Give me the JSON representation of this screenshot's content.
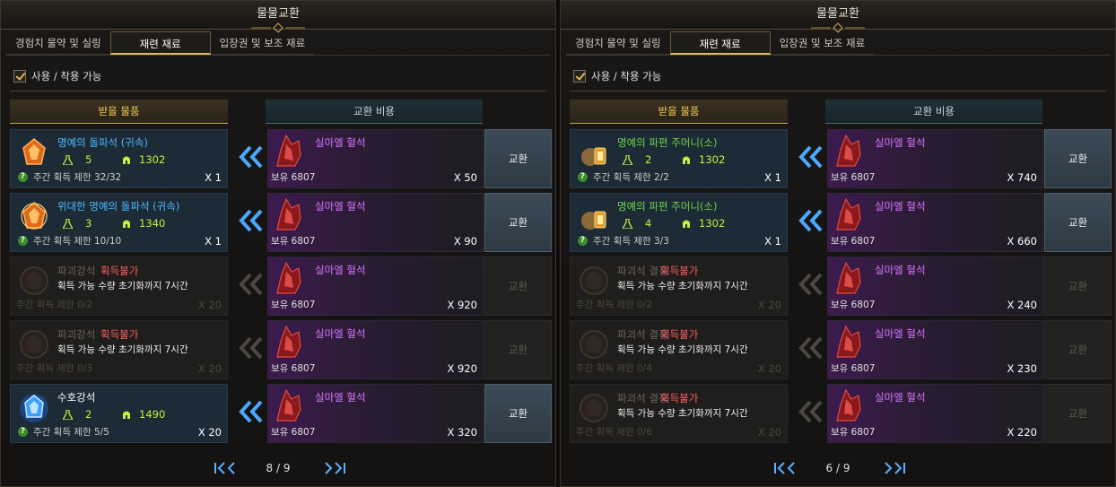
{
  "panels": [
    {
      "title": "물물교환",
      "tabs": [
        "경험치 물약 및 실링",
        "재련 재료",
        "입장권 및 보조 재료"
      ],
      "active_tab": 1,
      "checkbox_label": "사용 / 착용 가능",
      "header_receive": "받을 물품",
      "header_cost": "교환 비용",
      "page": "8 / 9",
      "rows": [
        {
          "state": "ok",
          "icon": "orange-stone-icon",
          "name": "명예의 돌파석 (귀속)",
          "color": "blue",
          "stat1": "5",
          "stat2": "1302",
          "limit": "주간 획득 제한 32/32",
          "qty": "X 1",
          "cost_name": "실마엘 혈석",
          "cost_own": "보유 6807",
          "cost_qty": "X 50",
          "btn": "교환"
        },
        {
          "state": "ok",
          "icon": "great-orange-stone-icon",
          "name": "위대한 명예의 돌파석 (귀속)",
          "color": "blue",
          "stat1": "3",
          "stat2": "1340",
          "limit": "주간 획득 제한 10/10",
          "qty": "X 1",
          "cost_name": "실마엘 혈석",
          "cost_own": "보유 6807",
          "cost_qty": "X 90",
          "btn": "교환"
        },
        {
          "state": "dim",
          "icon": "destruction-stone-icon",
          "name": "파괴강석",
          "unavail": "획득불가",
          "reset": "획득 가능 수량 초기화까지 7시간",
          "limit": "주간 획득 제한 0/2",
          "qty": "X 20",
          "cost_name": "실마엘 혈석",
          "cost_own": "보유 6807",
          "cost_qty": "X 920",
          "btn": "교환"
        },
        {
          "state": "dim",
          "icon": "destruction-stone-icon",
          "name": "파괴강석",
          "unavail": "획득불가",
          "reset": "획득 가능 수량 초기화까지 7시간",
          "limit": "주간 획득 제한 0/3",
          "qty": "X 20",
          "cost_name": "실마엘 혈석",
          "cost_own": "보유 6807",
          "cost_qty": "X 920",
          "btn": "교환"
        },
        {
          "state": "ok",
          "icon": "guardian-stone-icon",
          "name": "수호강석",
          "color": "white",
          "stat1": "2",
          "stat2": "1490",
          "limit": "주간 획득 제한 5/5",
          "qty": "X 20",
          "cost_name": "실마엘 혈석",
          "cost_own": "보유 6807",
          "cost_qty": "X 320",
          "btn": "교환"
        }
      ]
    },
    {
      "title": "물물교환",
      "tabs": [
        "경험치 물약 및 실링",
        "재련 재료",
        "입장권 및 보조 재료"
      ],
      "active_tab": 1,
      "checkbox_label": "사용 / 착용 가능",
      "header_receive": "받을 물품",
      "header_cost": "교환 비용",
      "page": "6 / 9",
      "rows": [
        {
          "state": "ok",
          "icon": "shard-pouch-icon",
          "name": "명예의 파편 주머니(소)",
          "color": "green",
          "stat1": "2",
          "stat2": "1302",
          "limit": "주간 획득 제한 2/2",
          "qty": "X 1",
          "cost_name": "실마엘 혈석",
          "cost_own": "보유 6807",
          "cost_qty": "X 740",
          "btn": "교환"
        },
        {
          "state": "ok",
          "icon": "shard-pouch-icon",
          "name": "명예의 파편 주머니(소)",
          "color": "green",
          "stat1": "4",
          "stat2": "1302",
          "limit": "주간 획득 제한 3/3",
          "qty": "X 1",
          "cost_name": "실마엘 혈석",
          "cost_own": "보유 6807",
          "cost_qty": "X 660",
          "btn": "교환"
        },
        {
          "state": "dim",
          "icon": "destruction-crystal-icon",
          "name": "파괴석 결정",
          "unavail": "획득불가",
          "reset": "획득 가능 수량 초기화까지 7시간",
          "limit": "주간 획득 제한 0/2",
          "qty": "X 20",
          "cost_name": "실마엘 혈석",
          "cost_own": "보유 6807",
          "cost_qty": "X 240",
          "btn": "교환"
        },
        {
          "state": "dim",
          "icon": "destruction-crystal-icon",
          "name": "파괴석 결정",
          "unavail": "획득불가",
          "reset": "획득 가능 수량 초기화까지 7시간",
          "limit": "주간 획득 제한 0/4",
          "qty": "X 20",
          "cost_name": "실마엘 혈석",
          "cost_own": "보유 6807",
          "cost_qty": "X 230",
          "btn": "교환"
        },
        {
          "state": "dim",
          "icon": "destruction-crystal-icon",
          "name": "파괴석 결정",
          "unavail": "획득불가",
          "reset": "획득 가능 수량 초기화까지 7시간",
          "limit": "주간 획득 제한 0/6",
          "qty": "X 20",
          "cost_name": "실마엘 혈석",
          "cost_own": "보유 6807",
          "cost_qty": "X 220",
          "btn": "교환"
        }
      ]
    }
  ],
  "colors": {
    "blue": "#4eb8ff",
    "green": "#6ed14a",
    "gold": "#f0c85a",
    "unavailable": "#ff5e5e",
    "cost_purple": "#d675ff"
  }
}
